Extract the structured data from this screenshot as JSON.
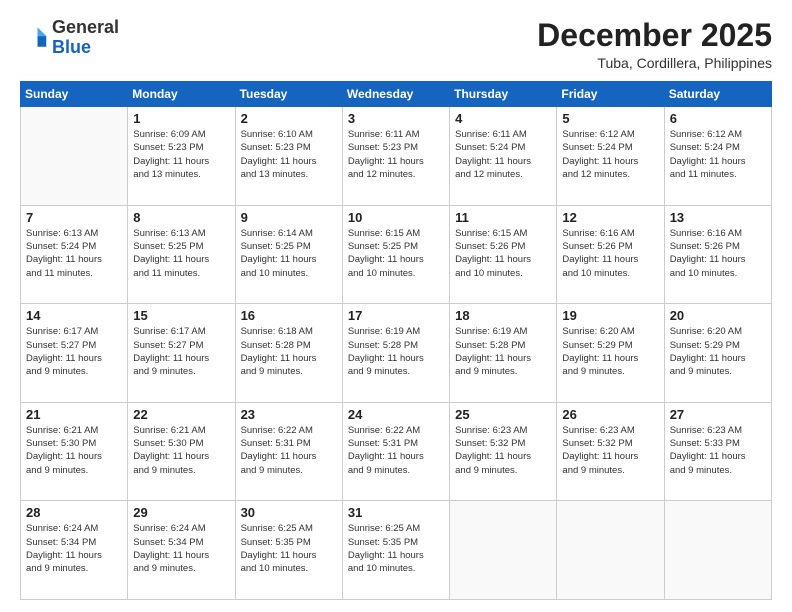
{
  "header": {
    "logo_general": "General",
    "logo_blue": "Blue",
    "month": "December 2025",
    "location": "Tuba, Cordillera, Philippines"
  },
  "weekdays": [
    "Sunday",
    "Monday",
    "Tuesday",
    "Wednesday",
    "Thursday",
    "Friday",
    "Saturday"
  ],
  "weeks": [
    [
      {
        "day": "",
        "info": ""
      },
      {
        "day": "1",
        "info": "Sunrise: 6:09 AM\nSunset: 5:23 PM\nDaylight: 11 hours\nand 13 minutes."
      },
      {
        "day": "2",
        "info": "Sunrise: 6:10 AM\nSunset: 5:23 PM\nDaylight: 11 hours\nand 13 minutes."
      },
      {
        "day": "3",
        "info": "Sunrise: 6:11 AM\nSunset: 5:23 PM\nDaylight: 11 hours\nand 12 minutes."
      },
      {
        "day": "4",
        "info": "Sunrise: 6:11 AM\nSunset: 5:24 PM\nDaylight: 11 hours\nand 12 minutes."
      },
      {
        "day": "5",
        "info": "Sunrise: 6:12 AM\nSunset: 5:24 PM\nDaylight: 11 hours\nand 12 minutes."
      },
      {
        "day": "6",
        "info": "Sunrise: 6:12 AM\nSunset: 5:24 PM\nDaylight: 11 hours\nand 11 minutes."
      }
    ],
    [
      {
        "day": "7",
        "info": "Sunrise: 6:13 AM\nSunset: 5:24 PM\nDaylight: 11 hours\nand 11 minutes."
      },
      {
        "day": "8",
        "info": "Sunrise: 6:13 AM\nSunset: 5:25 PM\nDaylight: 11 hours\nand 11 minutes."
      },
      {
        "day": "9",
        "info": "Sunrise: 6:14 AM\nSunset: 5:25 PM\nDaylight: 11 hours\nand 10 minutes."
      },
      {
        "day": "10",
        "info": "Sunrise: 6:15 AM\nSunset: 5:25 PM\nDaylight: 11 hours\nand 10 minutes."
      },
      {
        "day": "11",
        "info": "Sunrise: 6:15 AM\nSunset: 5:26 PM\nDaylight: 11 hours\nand 10 minutes."
      },
      {
        "day": "12",
        "info": "Sunrise: 6:16 AM\nSunset: 5:26 PM\nDaylight: 11 hours\nand 10 minutes."
      },
      {
        "day": "13",
        "info": "Sunrise: 6:16 AM\nSunset: 5:26 PM\nDaylight: 11 hours\nand 10 minutes."
      }
    ],
    [
      {
        "day": "14",
        "info": "Sunrise: 6:17 AM\nSunset: 5:27 PM\nDaylight: 11 hours\nand 9 minutes."
      },
      {
        "day": "15",
        "info": "Sunrise: 6:17 AM\nSunset: 5:27 PM\nDaylight: 11 hours\nand 9 minutes."
      },
      {
        "day": "16",
        "info": "Sunrise: 6:18 AM\nSunset: 5:28 PM\nDaylight: 11 hours\nand 9 minutes."
      },
      {
        "day": "17",
        "info": "Sunrise: 6:19 AM\nSunset: 5:28 PM\nDaylight: 11 hours\nand 9 minutes."
      },
      {
        "day": "18",
        "info": "Sunrise: 6:19 AM\nSunset: 5:28 PM\nDaylight: 11 hours\nand 9 minutes."
      },
      {
        "day": "19",
        "info": "Sunrise: 6:20 AM\nSunset: 5:29 PM\nDaylight: 11 hours\nand 9 minutes."
      },
      {
        "day": "20",
        "info": "Sunrise: 6:20 AM\nSunset: 5:29 PM\nDaylight: 11 hours\nand 9 minutes."
      }
    ],
    [
      {
        "day": "21",
        "info": "Sunrise: 6:21 AM\nSunset: 5:30 PM\nDaylight: 11 hours\nand 9 minutes."
      },
      {
        "day": "22",
        "info": "Sunrise: 6:21 AM\nSunset: 5:30 PM\nDaylight: 11 hours\nand 9 minutes."
      },
      {
        "day": "23",
        "info": "Sunrise: 6:22 AM\nSunset: 5:31 PM\nDaylight: 11 hours\nand 9 minutes."
      },
      {
        "day": "24",
        "info": "Sunrise: 6:22 AM\nSunset: 5:31 PM\nDaylight: 11 hours\nand 9 minutes."
      },
      {
        "day": "25",
        "info": "Sunrise: 6:23 AM\nSunset: 5:32 PM\nDaylight: 11 hours\nand 9 minutes."
      },
      {
        "day": "26",
        "info": "Sunrise: 6:23 AM\nSunset: 5:32 PM\nDaylight: 11 hours\nand 9 minutes."
      },
      {
        "day": "27",
        "info": "Sunrise: 6:23 AM\nSunset: 5:33 PM\nDaylight: 11 hours\nand 9 minutes."
      }
    ],
    [
      {
        "day": "28",
        "info": "Sunrise: 6:24 AM\nSunset: 5:34 PM\nDaylight: 11 hours\nand 9 minutes."
      },
      {
        "day": "29",
        "info": "Sunrise: 6:24 AM\nSunset: 5:34 PM\nDaylight: 11 hours\nand 9 minutes."
      },
      {
        "day": "30",
        "info": "Sunrise: 6:25 AM\nSunset: 5:35 PM\nDaylight: 11 hours\nand 10 minutes."
      },
      {
        "day": "31",
        "info": "Sunrise: 6:25 AM\nSunset: 5:35 PM\nDaylight: 11 hours\nand 10 minutes."
      },
      {
        "day": "",
        "info": ""
      },
      {
        "day": "",
        "info": ""
      },
      {
        "day": "",
        "info": ""
      }
    ]
  ]
}
